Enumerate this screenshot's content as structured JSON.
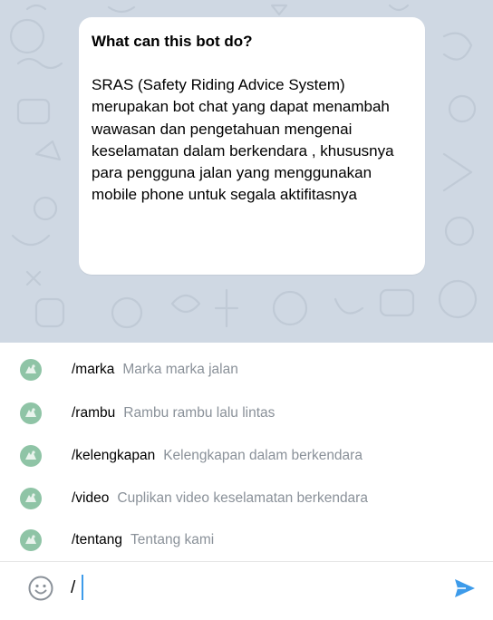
{
  "colors": {
    "chat_background": "#cfd8e3",
    "accent": "#3d9bea",
    "command_description": "#8a9199",
    "bot_avatar": "#8fc4a6"
  },
  "info_card": {
    "title": "What can this bot do?",
    "body": "SRAS (Safety Riding Advice System) merupakan bot chat yang dapat menambah wawasan dan pengetahuan mengenai keselamatan dalam berkendara , khususnya para pengguna jalan yang menggunakan mobile phone untuk segala aktifitasnya"
  },
  "commands": [
    {
      "name": "/marka",
      "description": "Marka marka jalan",
      "icon": "bot-avatar-icon"
    },
    {
      "name": "/rambu",
      "description": "Rambu rambu lalu lintas",
      "icon": "bot-avatar-icon"
    },
    {
      "name": "/kelengkapan",
      "description": "Kelengkapan dalam berkendara",
      "icon": "bot-avatar-icon"
    },
    {
      "name": "/video",
      "description": "Cuplikan video keselamatan berkendara",
      "icon": "bot-avatar-icon"
    },
    {
      "name": "/tentang",
      "description": "Tentang kami",
      "icon": "bot-avatar-icon"
    }
  ],
  "input_bar": {
    "value": "/",
    "emoji_icon": "smiley-icon",
    "send_icon": "send-arrow-icon"
  }
}
